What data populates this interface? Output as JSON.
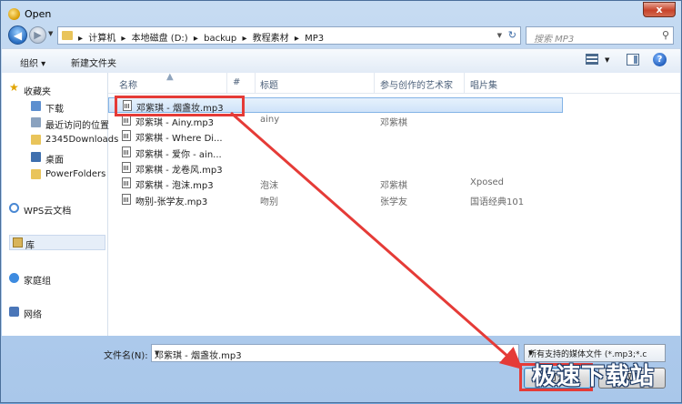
{
  "window": {
    "title": "Open",
    "close_label": "x"
  },
  "address": {
    "crumbs": [
      "计算机",
      "本地磁盘 (D:)",
      "backup",
      "教程素材",
      "MP3"
    ],
    "separator": "▸"
  },
  "search": {
    "placeholder": "搜索 MP3"
  },
  "toolbar": {
    "organize_label": "组织 ▾",
    "new_folder_label": "新建文件夹",
    "help_label": "?"
  },
  "sidebar": {
    "favorites_label": "收藏夹",
    "items": [
      {
        "label": "下载"
      },
      {
        "label": "最近访问的位置"
      },
      {
        "label": "2345Downloads"
      },
      {
        "label": "桌面"
      },
      {
        "label": "PowerFolders"
      }
    ],
    "wps_label": "WPS云文档",
    "library_label": "库",
    "homegroup_label": "家庭组",
    "network_label": "网络"
  },
  "columns": {
    "name": "名称",
    "number": "#",
    "title": "标题",
    "artist": "参与创作的艺术家",
    "album": "唱片集"
  },
  "files": [
    {
      "name": "邓紫琪 - 烟盏妆.mp3",
      "title": "",
      "artist": "",
      "album": ""
    },
    {
      "name": "邓紫琪 - Ainy.mp3",
      "title": "ainy",
      "artist": "邓紫棋",
      "album": ""
    },
    {
      "name": "邓紫棋 - Where Di...",
      "title": "",
      "artist": "",
      "album": ""
    },
    {
      "name": "邓紫棋 - 爱你 - ain...",
      "title": "",
      "artist": "",
      "album": ""
    },
    {
      "name": "邓紫棋 - 龙卷风.mp3",
      "title": "",
      "artist": "",
      "album": ""
    },
    {
      "name": "邓紫棋 - 泡沫.mp3",
      "title": "泡沫",
      "artist": "邓紫棋",
      "album": "Xposed"
    },
    {
      "name": "吻别-张学友.mp3",
      "title": "吻别",
      "artist": "张学友",
      "album": "国语经典101"
    }
  ],
  "bottom": {
    "filename_label": "文件名(N):",
    "filename_value": "邓紫琪 - 烟盏妆.mp3",
    "filetype_value": "所有支持的媒体文件 (*.mp3;*.c",
    "open_label": "打开",
    "cancel_label": "取消"
  },
  "watermark": "极速下载站",
  "colors": {
    "highlight": "#e53b37",
    "selection": "#cfe3f9",
    "chrome": "#b4cfee"
  }
}
